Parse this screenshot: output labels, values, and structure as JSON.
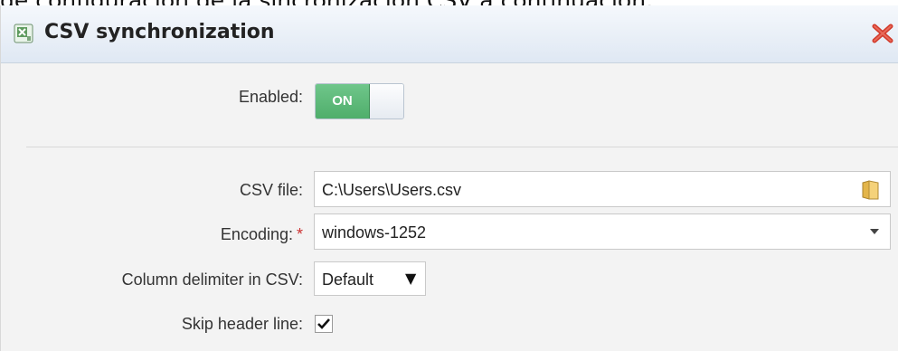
{
  "caption": "de configuración de la sincronización CSV a continuación:",
  "dialog": {
    "title": "CSV synchronization"
  },
  "form": {
    "enabled": {
      "label": "Enabled:",
      "state_text": "ON",
      "is_on": true
    },
    "csv_file": {
      "label": "CSV file:",
      "value": "C:\\Users\\Users.csv"
    },
    "encoding": {
      "label": "Encoding:",
      "required_marker": "*",
      "value": "windows-1252"
    },
    "column_delimiter": {
      "label": "Column delimiter in CSV:",
      "value": "Default"
    },
    "skip_header": {
      "label": "Skip header line:",
      "checked": true
    }
  },
  "colors": {
    "toggle_on": "#4fae6b",
    "required": "#cc3333",
    "close": "#c0392b"
  },
  "icons": {
    "title": "excel-sheet-icon",
    "close": "close-icon",
    "browse": "folder-icon",
    "dropdown": "chevron-down-icon",
    "check": "checkmark-icon"
  }
}
